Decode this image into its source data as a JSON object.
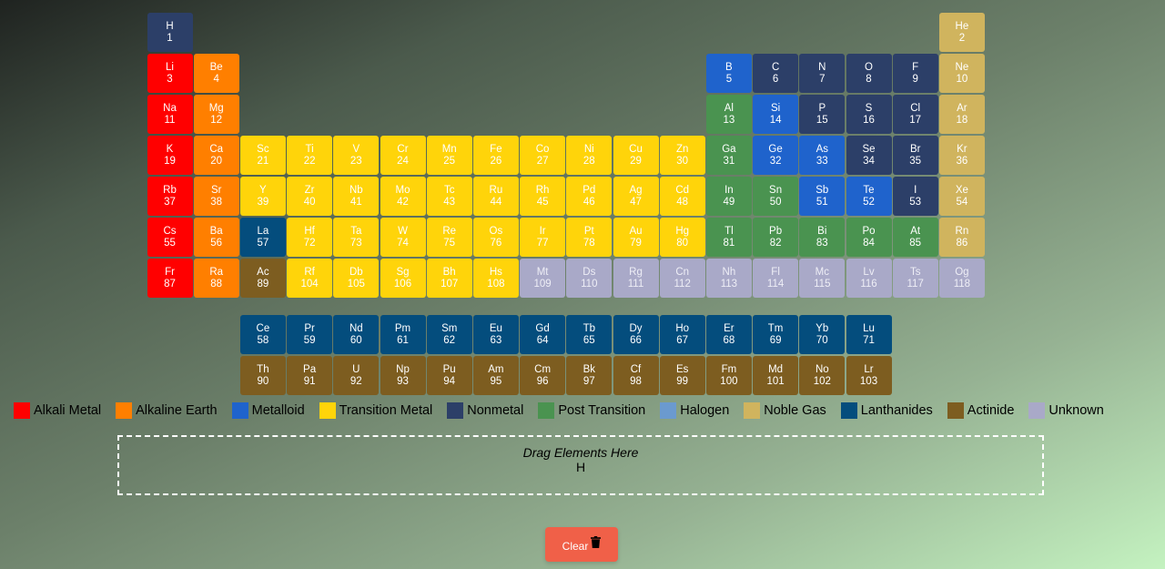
{
  "colors": {
    "alkali": "#ff0000",
    "alkaline": "#ff7f00",
    "metalloid": "#1f63cc",
    "transition": "#ffd40a",
    "nonmetal": "#2c3f68",
    "post": "#4a9350",
    "halogen": "#6b9acf",
    "noble": "#d0b45e",
    "lanthanide": "#044d7d",
    "actinide": "#7d5d20",
    "unknown": "#a9a9c8"
  },
  "legend": [
    {
      "label": "Alkali Metal",
      "cat": "alkali"
    },
    {
      "label": "Alkaline Earth",
      "cat": "alkaline"
    },
    {
      "label": "Metalloid",
      "cat": "metalloid"
    },
    {
      "label": "Transition Metal",
      "cat": "transition"
    },
    {
      "label": "Nonmetal",
      "cat": "nonmetal"
    },
    {
      "label": "Post Transition",
      "cat": "post"
    },
    {
      "label": "Halogen",
      "cat": "halogen"
    },
    {
      "label": "Noble Gas",
      "cat": "noble"
    },
    {
      "label": "Lanthanides",
      "cat": "lanthanide"
    },
    {
      "label": "Actinide",
      "cat": "actinide"
    },
    {
      "label": "Unknown",
      "cat": "unknown"
    }
  ],
  "elements": [
    {
      "symbol": "H",
      "number": 1,
      "period": 1,
      "group": 1,
      "cat": "nonmetal"
    },
    {
      "symbol": "He",
      "number": 2,
      "period": 1,
      "group": 18,
      "cat": "noble"
    },
    {
      "symbol": "Li",
      "number": 3,
      "period": 2,
      "group": 1,
      "cat": "alkali"
    },
    {
      "symbol": "Be",
      "number": 4,
      "period": 2,
      "group": 2,
      "cat": "alkaline"
    },
    {
      "symbol": "B",
      "number": 5,
      "period": 2,
      "group": 13,
      "cat": "metalloid"
    },
    {
      "symbol": "C",
      "number": 6,
      "period": 2,
      "group": 14,
      "cat": "nonmetal"
    },
    {
      "symbol": "N",
      "number": 7,
      "period": 2,
      "group": 15,
      "cat": "nonmetal"
    },
    {
      "symbol": "O",
      "number": 8,
      "period": 2,
      "group": 16,
      "cat": "nonmetal"
    },
    {
      "symbol": "F",
      "number": 9,
      "period": 2,
      "group": 17,
      "cat": "nonmetal"
    },
    {
      "symbol": "Ne",
      "number": 10,
      "period": 2,
      "group": 18,
      "cat": "noble"
    },
    {
      "symbol": "Na",
      "number": 11,
      "period": 3,
      "group": 1,
      "cat": "alkali"
    },
    {
      "symbol": "Mg",
      "number": 12,
      "period": 3,
      "group": 2,
      "cat": "alkaline"
    },
    {
      "symbol": "Al",
      "number": 13,
      "period": 3,
      "group": 13,
      "cat": "post"
    },
    {
      "symbol": "Si",
      "number": 14,
      "period": 3,
      "group": 14,
      "cat": "metalloid"
    },
    {
      "symbol": "P",
      "number": 15,
      "period": 3,
      "group": 15,
      "cat": "nonmetal"
    },
    {
      "symbol": "S",
      "number": 16,
      "period": 3,
      "group": 16,
      "cat": "nonmetal"
    },
    {
      "symbol": "Cl",
      "number": 17,
      "period": 3,
      "group": 17,
      "cat": "nonmetal"
    },
    {
      "symbol": "Ar",
      "number": 18,
      "period": 3,
      "group": 18,
      "cat": "noble"
    },
    {
      "symbol": "K",
      "number": 19,
      "period": 4,
      "group": 1,
      "cat": "alkali"
    },
    {
      "symbol": "Ca",
      "number": 20,
      "period": 4,
      "group": 2,
      "cat": "alkaline"
    },
    {
      "symbol": "Sc",
      "number": 21,
      "period": 4,
      "group": 3,
      "cat": "transition"
    },
    {
      "symbol": "Ti",
      "number": 22,
      "period": 4,
      "group": 4,
      "cat": "transition"
    },
    {
      "symbol": "V",
      "number": 23,
      "period": 4,
      "group": 5,
      "cat": "transition"
    },
    {
      "symbol": "Cr",
      "number": 24,
      "period": 4,
      "group": 6,
      "cat": "transition"
    },
    {
      "symbol": "Mn",
      "number": 25,
      "period": 4,
      "group": 7,
      "cat": "transition"
    },
    {
      "symbol": "Fe",
      "number": 26,
      "period": 4,
      "group": 8,
      "cat": "transition"
    },
    {
      "symbol": "Co",
      "number": 27,
      "period": 4,
      "group": 9,
      "cat": "transition"
    },
    {
      "symbol": "Ni",
      "number": 28,
      "period": 4,
      "group": 10,
      "cat": "transition"
    },
    {
      "symbol": "Cu",
      "number": 29,
      "period": 4,
      "group": 11,
      "cat": "transition"
    },
    {
      "symbol": "Zn",
      "number": 30,
      "period": 4,
      "group": 12,
      "cat": "transition"
    },
    {
      "symbol": "Ga",
      "number": 31,
      "period": 4,
      "group": 13,
      "cat": "post"
    },
    {
      "symbol": "Ge",
      "number": 32,
      "period": 4,
      "group": 14,
      "cat": "metalloid"
    },
    {
      "symbol": "As",
      "number": 33,
      "period": 4,
      "group": 15,
      "cat": "metalloid"
    },
    {
      "symbol": "Se",
      "number": 34,
      "period": 4,
      "group": 16,
      "cat": "nonmetal"
    },
    {
      "symbol": "Br",
      "number": 35,
      "period": 4,
      "group": 17,
      "cat": "nonmetal"
    },
    {
      "symbol": "Kr",
      "number": 36,
      "period": 4,
      "group": 18,
      "cat": "noble"
    },
    {
      "symbol": "Rb",
      "number": 37,
      "period": 5,
      "group": 1,
      "cat": "alkali"
    },
    {
      "symbol": "Sr",
      "number": 38,
      "period": 5,
      "group": 2,
      "cat": "alkaline"
    },
    {
      "symbol": "Y",
      "number": 39,
      "period": 5,
      "group": 3,
      "cat": "transition"
    },
    {
      "symbol": "Zr",
      "number": 40,
      "period": 5,
      "group": 4,
      "cat": "transition"
    },
    {
      "symbol": "Nb",
      "number": 41,
      "period": 5,
      "group": 5,
      "cat": "transition"
    },
    {
      "symbol": "Mo",
      "number": 42,
      "period": 5,
      "group": 6,
      "cat": "transition"
    },
    {
      "symbol": "Tc",
      "number": 43,
      "period": 5,
      "group": 7,
      "cat": "transition"
    },
    {
      "symbol": "Ru",
      "number": 44,
      "period": 5,
      "group": 8,
      "cat": "transition"
    },
    {
      "symbol": "Rh",
      "number": 45,
      "period": 5,
      "group": 9,
      "cat": "transition"
    },
    {
      "symbol": "Pd",
      "number": 46,
      "period": 5,
      "group": 10,
      "cat": "transition"
    },
    {
      "symbol": "Ag",
      "number": 47,
      "period": 5,
      "group": 11,
      "cat": "transition"
    },
    {
      "symbol": "Cd",
      "number": 48,
      "period": 5,
      "group": 12,
      "cat": "transition"
    },
    {
      "symbol": "In",
      "number": 49,
      "period": 5,
      "group": 13,
      "cat": "post"
    },
    {
      "symbol": "Sn",
      "number": 50,
      "period": 5,
      "group": 14,
      "cat": "post"
    },
    {
      "symbol": "Sb",
      "number": 51,
      "period": 5,
      "group": 15,
      "cat": "metalloid"
    },
    {
      "symbol": "Te",
      "number": 52,
      "period": 5,
      "group": 16,
      "cat": "metalloid"
    },
    {
      "symbol": "I",
      "number": 53,
      "period": 5,
      "group": 17,
      "cat": "nonmetal"
    },
    {
      "symbol": "Xe",
      "number": 54,
      "period": 5,
      "group": 18,
      "cat": "noble"
    },
    {
      "symbol": "Cs",
      "number": 55,
      "period": 6,
      "group": 1,
      "cat": "alkali"
    },
    {
      "symbol": "Ba",
      "number": 56,
      "period": 6,
      "group": 2,
      "cat": "alkaline"
    },
    {
      "symbol": "La",
      "number": 57,
      "period": 6,
      "group": 3,
      "cat": "lanthanide"
    },
    {
      "symbol": "Hf",
      "number": 72,
      "period": 6,
      "group": 4,
      "cat": "transition"
    },
    {
      "symbol": "Ta",
      "number": 73,
      "period": 6,
      "group": 5,
      "cat": "transition"
    },
    {
      "symbol": "W",
      "number": 74,
      "period": 6,
      "group": 6,
      "cat": "transition"
    },
    {
      "symbol": "Re",
      "number": 75,
      "period": 6,
      "group": 7,
      "cat": "transition"
    },
    {
      "symbol": "Os",
      "number": 76,
      "period": 6,
      "group": 8,
      "cat": "transition"
    },
    {
      "symbol": "Ir",
      "number": 77,
      "period": 6,
      "group": 9,
      "cat": "transition"
    },
    {
      "symbol": "Pt",
      "number": 78,
      "period": 6,
      "group": 10,
      "cat": "transition"
    },
    {
      "symbol": "Au",
      "number": 79,
      "period": 6,
      "group": 11,
      "cat": "transition"
    },
    {
      "symbol": "Hg",
      "number": 80,
      "period": 6,
      "group": 12,
      "cat": "transition"
    },
    {
      "symbol": "Tl",
      "number": 81,
      "period": 6,
      "group": 13,
      "cat": "post"
    },
    {
      "symbol": "Pb",
      "number": 82,
      "period": 6,
      "group": 14,
      "cat": "post"
    },
    {
      "symbol": "Bi",
      "number": 83,
      "period": 6,
      "group": 15,
      "cat": "post"
    },
    {
      "symbol": "Po",
      "number": 84,
      "period": 6,
      "group": 16,
      "cat": "post"
    },
    {
      "symbol": "At",
      "number": 85,
      "period": 6,
      "group": 17,
      "cat": "post"
    },
    {
      "symbol": "Rn",
      "number": 86,
      "period": 6,
      "group": 18,
      "cat": "noble"
    },
    {
      "symbol": "Fr",
      "number": 87,
      "period": 7,
      "group": 1,
      "cat": "alkali"
    },
    {
      "symbol": "Ra",
      "number": 88,
      "period": 7,
      "group": 2,
      "cat": "alkaline"
    },
    {
      "symbol": "Ac",
      "number": 89,
      "period": 7,
      "group": 3,
      "cat": "actinide"
    },
    {
      "symbol": "Rf",
      "number": 104,
      "period": 7,
      "group": 4,
      "cat": "transition"
    },
    {
      "symbol": "Db",
      "number": 105,
      "period": 7,
      "group": 5,
      "cat": "transition"
    },
    {
      "symbol": "Sg",
      "number": 106,
      "period": 7,
      "group": 6,
      "cat": "transition"
    },
    {
      "symbol": "Bh",
      "number": 107,
      "period": 7,
      "group": 7,
      "cat": "transition"
    },
    {
      "symbol": "Hs",
      "number": 108,
      "period": 7,
      "group": 8,
      "cat": "transition"
    },
    {
      "symbol": "Mt",
      "number": 109,
      "period": 7,
      "group": 9,
      "cat": "unknown"
    },
    {
      "symbol": "Ds",
      "number": 110,
      "period": 7,
      "group": 10,
      "cat": "unknown"
    },
    {
      "symbol": "Rg",
      "number": 111,
      "period": 7,
      "group": 11,
      "cat": "unknown"
    },
    {
      "symbol": "Cn",
      "number": 112,
      "period": 7,
      "group": 12,
      "cat": "unknown"
    },
    {
      "symbol": "Nh",
      "number": 113,
      "period": 7,
      "group": 13,
      "cat": "unknown"
    },
    {
      "symbol": "Fl",
      "number": 114,
      "period": 7,
      "group": 14,
      "cat": "unknown"
    },
    {
      "symbol": "Mc",
      "number": 115,
      "period": 7,
      "group": 15,
      "cat": "unknown"
    },
    {
      "symbol": "Lv",
      "number": 116,
      "period": 7,
      "group": 16,
      "cat": "unknown"
    },
    {
      "symbol": "Ts",
      "number": 117,
      "period": 7,
      "group": 17,
      "cat": "unknown"
    },
    {
      "symbol": "Og",
      "number": 118,
      "period": 7,
      "group": 18,
      "cat": "unknown"
    },
    {
      "symbol": "Ce",
      "number": 58,
      "period": 9,
      "group": 3,
      "cat": "lanthanide"
    },
    {
      "symbol": "Pr",
      "number": 59,
      "period": 9,
      "group": 4,
      "cat": "lanthanide"
    },
    {
      "symbol": "Nd",
      "number": 60,
      "period": 9,
      "group": 5,
      "cat": "lanthanide"
    },
    {
      "symbol": "Pm",
      "number": 61,
      "period": 9,
      "group": 6,
      "cat": "lanthanide"
    },
    {
      "symbol": "Sm",
      "number": 62,
      "period": 9,
      "group": 7,
      "cat": "lanthanide"
    },
    {
      "symbol": "Eu",
      "number": 63,
      "period": 9,
      "group": 8,
      "cat": "lanthanide"
    },
    {
      "symbol": "Gd",
      "number": 64,
      "period": 9,
      "group": 9,
      "cat": "lanthanide"
    },
    {
      "symbol": "Tb",
      "number": 65,
      "period": 9,
      "group": 10,
      "cat": "lanthanide"
    },
    {
      "symbol": "Dy",
      "number": 66,
      "period": 9,
      "group": 11,
      "cat": "lanthanide"
    },
    {
      "symbol": "Ho",
      "number": 67,
      "period": 9,
      "group": 12,
      "cat": "lanthanide"
    },
    {
      "symbol": "Er",
      "number": 68,
      "period": 9,
      "group": 13,
      "cat": "lanthanide"
    },
    {
      "symbol": "Tm",
      "number": 69,
      "period": 9,
      "group": 14,
      "cat": "lanthanide"
    },
    {
      "symbol": "Yb",
      "number": 70,
      "period": 9,
      "group": 15,
      "cat": "lanthanide"
    },
    {
      "symbol": "Lu",
      "number": 71,
      "period": 9,
      "group": 16,
      "cat": "lanthanide"
    },
    {
      "symbol": "Th",
      "number": 90,
      "period": 10,
      "group": 3,
      "cat": "actinide"
    },
    {
      "symbol": "Pa",
      "number": 91,
      "period": 10,
      "group": 4,
      "cat": "actinide"
    },
    {
      "symbol": "U",
      "number": 92,
      "period": 10,
      "group": 5,
      "cat": "actinide"
    },
    {
      "symbol": "Np",
      "number": 93,
      "period": 10,
      "group": 6,
      "cat": "actinide"
    },
    {
      "symbol": "Pu",
      "number": 94,
      "period": 10,
      "group": 7,
      "cat": "actinide"
    },
    {
      "symbol": "Am",
      "number": 95,
      "period": 10,
      "group": 8,
      "cat": "actinide"
    },
    {
      "symbol": "Cm",
      "number": 96,
      "period": 10,
      "group": 9,
      "cat": "actinide"
    },
    {
      "symbol": "Bk",
      "number": 97,
      "period": 10,
      "group": 10,
      "cat": "actinide"
    },
    {
      "symbol": "Cf",
      "number": 98,
      "period": 10,
      "group": 11,
      "cat": "actinide"
    },
    {
      "symbol": "Es",
      "number": 99,
      "period": 10,
      "group": 12,
      "cat": "actinide"
    },
    {
      "symbol": "Fm",
      "number": 100,
      "period": 10,
      "group": 13,
      "cat": "actinide"
    },
    {
      "symbol": "Md",
      "number": 101,
      "period": 10,
      "group": 14,
      "cat": "actinide"
    },
    {
      "symbol": "No",
      "number": 102,
      "period": 10,
      "group": 15,
      "cat": "actinide"
    },
    {
      "symbol": "Lr",
      "number": 103,
      "period": 10,
      "group": 16,
      "cat": "actinide"
    }
  ],
  "dropzone": {
    "title": "Drag Elements Here",
    "content": "H"
  },
  "clear_button": {
    "label": "Clear",
    "icon": "trash-icon"
  }
}
